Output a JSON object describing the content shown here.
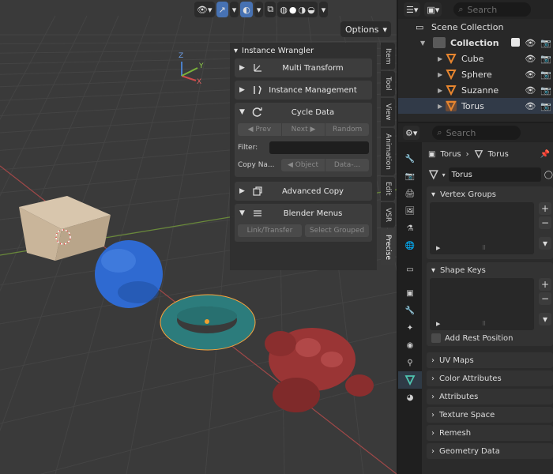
{
  "viewport": {
    "options_label": "Options",
    "axis_labels": {
      "x": "X",
      "y": "Y",
      "z": "Z"
    }
  },
  "npanel": {
    "title": "Instance Wrangler",
    "sections": [
      {
        "label": "Multi Transform",
        "expanded": false,
        "icon": "transform-axes-icon"
      },
      {
        "label": "Instance Management",
        "expanded": false,
        "icon": "tools-icon"
      },
      {
        "label": "Cycle Data",
        "expanded": true,
        "icon": "cycle-icon"
      },
      {
        "label": "Advanced Copy",
        "expanded": false,
        "icon": "copy-icon"
      },
      {
        "label": "Blender Menus",
        "expanded": true,
        "icon": "menu-icon"
      }
    ],
    "cycle": {
      "prev": "Prev",
      "next": "Next",
      "random": "Random",
      "filter_label": "Filter:",
      "copy_label": "Copy Na...",
      "object": "Object",
      "data": "Data-..."
    },
    "menus": {
      "link": "Link/Transfer",
      "select": "Select Grouped"
    }
  },
  "vtabs": [
    "Item",
    "Tool",
    "View",
    "Animation",
    "Edit",
    "VSR",
    "Precise"
  ],
  "vtabs_active": "Precise",
  "outliner": {
    "search_placeholder": "Search",
    "scene_collection": "Scene Collection",
    "collection": "Collection",
    "objects": [
      "Cube",
      "Sphere",
      "Suzanne",
      "Torus"
    ]
  },
  "properties": {
    "search_placeholder": "Search",
    "breadcrumb": [
      "Torus",
      "Torus"
    ],
    "mesh_name": "Torus",
    "vertex_groups": "Vertex Groups",
    "shape_keys": "Shape Keys",
    "add_rest_position": "Add Rest Position",
    "collapsed_panels": [
      "UV Maps",
      "Color Attributes",
      "Attributes",
      "Texture Space",
      "Remesh",
      "Geometry Data"
    ]
  },
  "colors": {
    "accent": "#4772b3",
    "grid_bg": "#3a3a3a",
    "cube": "#c9b59a",
    "sphere": "#2f6ad1",
    "torus": "#2c7c7c",
    "suzanne": "#9a3535"
  }
}
